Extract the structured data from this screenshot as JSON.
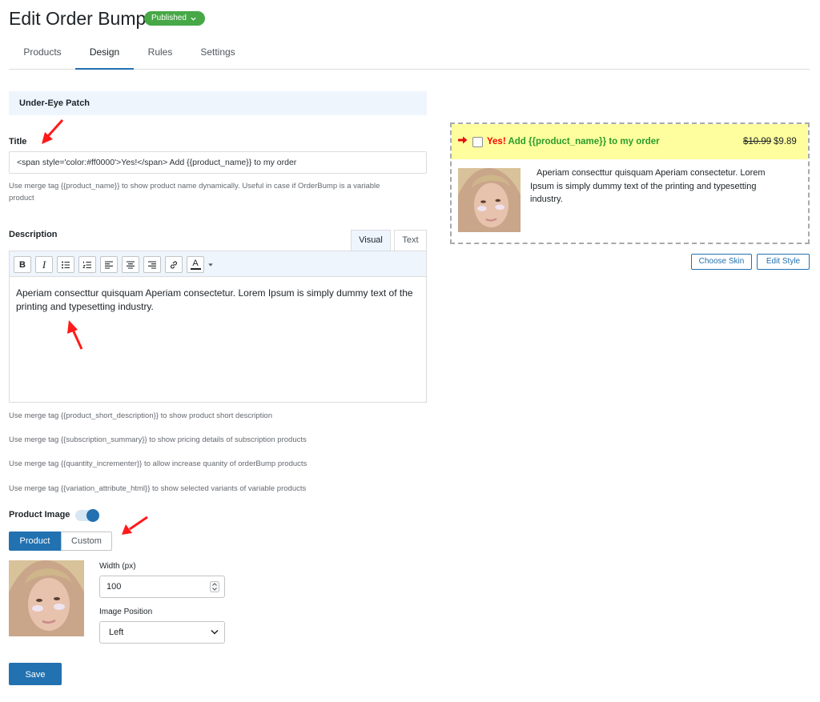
{
  "header": {
    "title": "Edit Order Bump",
    "status": "Published"
  },
  "tabs": [
    {
      "label": "Products"
    },
    {
      "label": "Design"
    },
    {
      "label": "Rules"
    },
    {
      "label": "Settings"
    }
  ],
  "product_name": "Under-Eye Patch",
  "title_field": {
    "label": "Title",
    "value": "<span style='color:#ff0000'>Yes!</span> Add {{product_name}} to my order",
    "help_line1": "Use merge tag {{product_name}} to show product name dynamically. Useful in case if OrderBump is a variable",
    "help_line2": "product"
  },
  "description": {
    "label": "Description",
    "tab_visual": "Visual",
    "tab_text": "Text",
    "toolbar": {
      "bold": "B",
      "italic": "I",
      "text_color": "A"
    },
    "content": "Aperiam consecttur quisquam Aperiam consectetur. Lorem Ipsum is simply dummy text of the printing and typesetting industry.",
    "help": [
      "Use merge tag {{product_short_description}} to show product short description",
      "Use merge tag {{subscription_summary}} to show pricing details of subscription products",
      "Use merge tag {{quantity_incrementer}} to allow increase quanity of orderBump products",
      "Use merge tag {{variation_attribute_html}} to show selected variants of variable products"
    ]
  },
  "product_image": {
    "label": "Product Image",
    "enabled": true,
    "source_product": "Product",
    "source_custom": "Custom",
    "width_label": "Width (px)",
    "width_value": "100",
    "position_label": "Image Position",
    "position_value": "Left"
  },
  "save_label": "Save",
  "preview": {
    "title_yes": "Yes!",
    "title_rest": " Add {{product_name}} to my order",
    "old_price": "$10.99",
    "new_price": "$9.89",
    "description": "Aperiam consecttur quisquam Aperiam consectetur. Lorem Ipsum is simply dummy text of the printing and typesetting industry.",
    "choose_skin": "Choose Skin",
    "edit_style": "Edit Style"
  },
  "colors": {
    "accent": "#2271b1",
    "published": "#46a846",
    "preview_bg": "#fefe9e",
    "preview_yes": "#ff0000",
    "preview_text": "#2a9d2a",
    "annotation": "#ff1a1a"
  }
}
